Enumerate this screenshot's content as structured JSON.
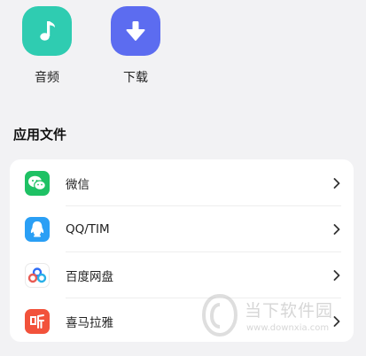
{
  "quick_actions": [
    {
      "label": "音频",
      "icon": "music-note-icon",
      "color": "#2fccb1"
    },
    {
      "label": "下载",
      "icon": "download-arrow-icon",
      "color": "#5c6cf0"
    }
  ],
  "section": {
    "title": "应用文件"
  },
  "apps": [
    {
      "name": "微信",
      "icon": "wechat-icon",
      "color": "#1ec164"
    },
    {
      "name": "QQ/TIM",
      "icon": "qq-penguin-icon",
      "color": "#2a9ff5"
    },
    {
      "name": "百度网盘",
      "icon": "baidu-netdisk-icon",
      "color": "#2f6df6"
    },
    {
      "name": "喜马拉雅",
      "icon": "ximalaya-icon",
      "color": "#f2523b"
    }
  ],
  "watermark": {
    "text": "当下软件园",
    "url": "www.downxia.com"
  }
}
